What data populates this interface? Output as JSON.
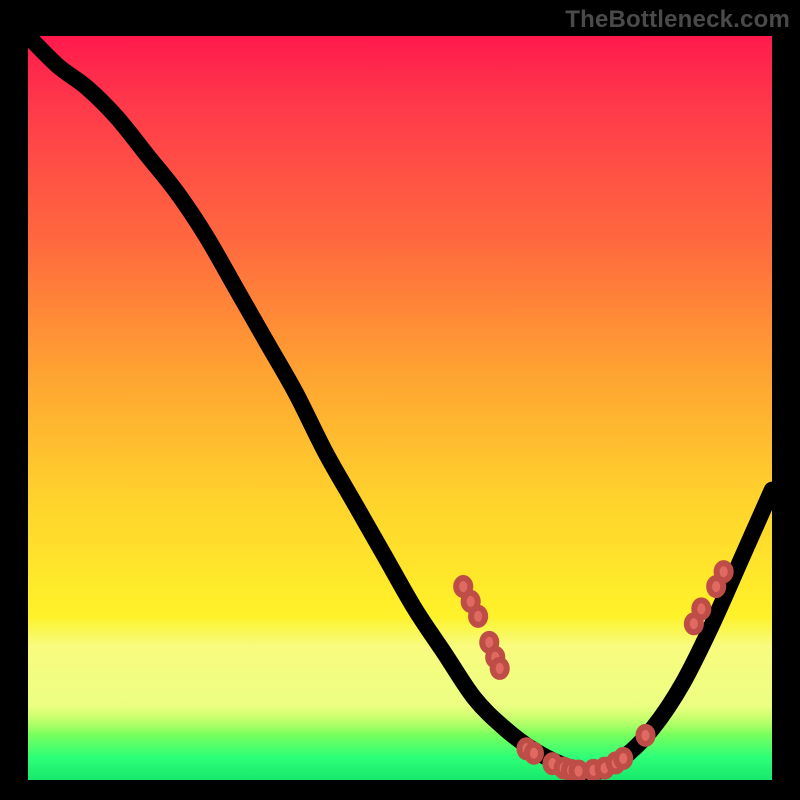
{
  "attribution": "TheBottleneck.com",
  "chart_data": {
    "type": "line",
    "title": "",
    "xlabel": "",
    "ylabel": "",
    "xlim": [
      0,
      100
    ],
    "ylim": [
      0,
      100
    ],
    "grid": false,
    "legend": false,
    "series": [
      {
        "name": "bottleneck-curve",
        "x": [
          0,
          4,
          8,
          12,
          16,
          20,
          24,
          28,
          32,
          36,
          40,
          44,
          48,
          52,
          56,
          60,
          64,
          68,
          72,
          76,
          80,
          84,
          88,
          92,
          96,
          100
        ],
        "y": [
          100,
          96,
          93,
          89,
          84,
          79,
          73,
          66,
          59,
          52,
          44,
          37,
          30,
          23,
          17,
          11,
          7,
          4,
          2,
          1,
          3,
          7,
          13,
          21,
          30,
          39
        ]
      }
    ],
    "markers": [
      {
        "x": 58.5,
        "y": 26.0
      },
      {
        "x": 59.5,
        "y": 24.0
      },
      {
        "x": 60.5,
        "y": 22.0
      },
      {
        "x": 62.0,
        "y": 18.5
      },
      {
        "x": 62.8,
        "y": 16.5
      },
      {
        "x": 63.4,
        "y": 15.0
      },
      {
        "x": 67.0,
        "y": 4.2
      },
      {
        "x": 68.0,
        "y": 3.6
      },
      {
        "x": 70.5,
        "y": 2.2
      },
      {
        "x": 72.0,
        "y": 1.6
      },
      {
        "x": 73.0,
        "y": 1.3
      },
      {
        "x": 74.0,
        "y": 1.2
      },
      {
        "x": 76.0,
        "y": 1.3
      },
      {
        "x": 77.5,
        "y": 1.6
      },
      {
        "x": 79.0,
        "y": 2.3
      },
      {
        "x": 80.0,
        "y": 2.9
      },
      {
        "x": 83.0,
        "y": 6.0
      },
      {
        "x": 89.5,
        "y": 21.0
      },
      {
        "x": 90.5,
        "y": 23.0
      },
      {
        "x": 92.5,
        "y": 26.0
      },
      {
        "x": 93.5,
        "y": 28.0
      }
    ],
    "gradient_stops": [
      {
        "pos": 0,
        "color": "#ff1a4d"
      },
      {
        "pos": 28,
        "color": "#ff6a3e"
      },
      {
        "pos": 62,
        "color": "#ffd22c"
      },
      {
        "pos": 90,
        "color": "#d4ff3a"
      },
      {
        "pos": 100,
        "color": "#17e86b"
      }
    ]
  }
}
